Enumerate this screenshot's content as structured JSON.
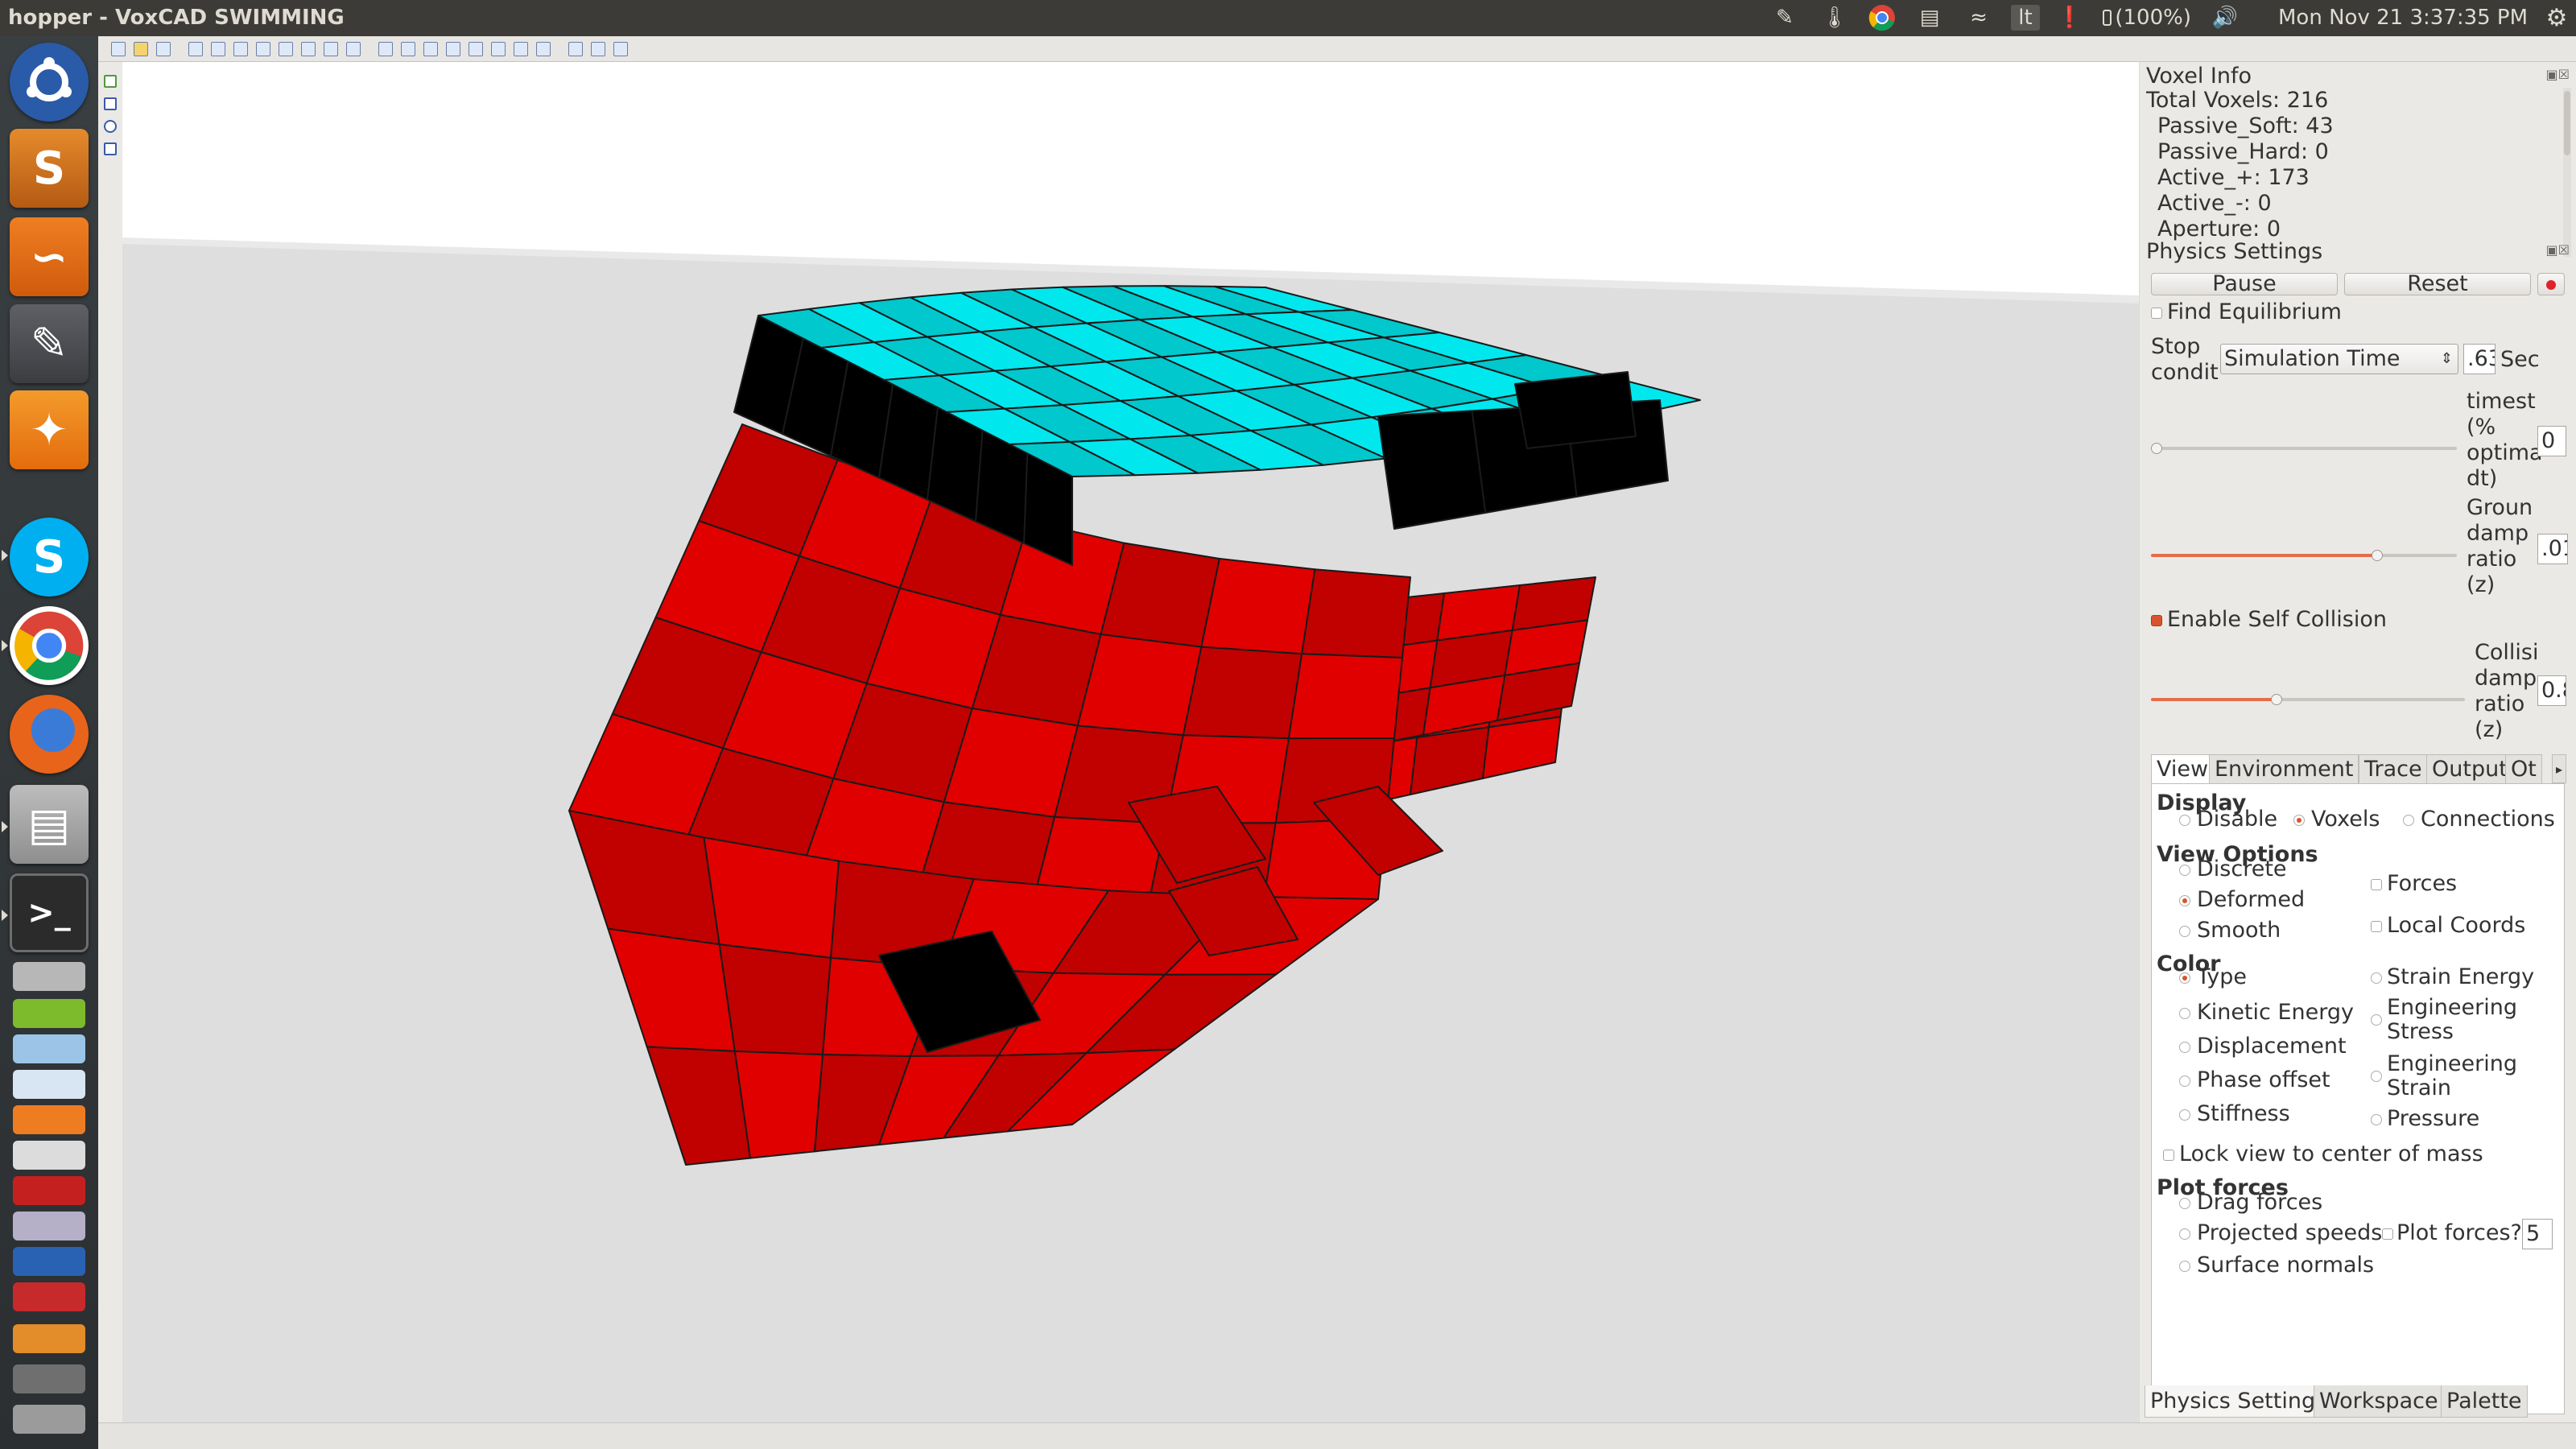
{
  "window": {
    "title": "hopper - VoxCAD SWIMMING"
  },
  "topbar": {
    "battery": "(100%)",
    "clock": "Mon Nov 21  3:37:35 PM",
    "keyboard": "lt"
  },
  "voxel_info": {
    "title": "Voxel Info",
    "lines": [
      "Total Voxels: 216",
      " Passive_Soft: 43",
      " Passive_Hard: 0",
      " Active_+: 173",
      " Active_-: 0",
      " Aperture: 0"
    ]
  },
  "physics": {
    "title": "Physics Settings",
    "pause_label": "Pause",
    "reset_label": "Reset",
    "find_equilibrium": "Find Equilibrium",
    "stop_label_1": "Stop",
    "stop_label_2": "condit",
    "stop_select": "Simulation Time",
    "stop_value": ".63",
    "stop_unit": "Sec",
    "timestep_label": [
      "timest",
      "(%",
      "optima",
      "dt)"
    ],
    "timestep_value": "0",
    "timestep_level": 0.0,
    "ground_label": [
      "Groun",
      "damp",
      "ratio",
      "(z)"
    ],
    "ground_value": ".01",
    "ground_level": 0.74,
    "self_collision": "Enable Self Collision",
    "coll_label": [
      "Collisi",
      "damp",
      "ratio",
      "(z)"
    ],
    "coll_value": "0.8",
    "coll_level": 0.4
  },
  "tabs": [
    "View",
    "Environment",
    "Trace",
    "Output",
    "Ot"
  ],
  "view": {
    "display_header": "Display",
    "disable": "Disable",
    "voxels": "Voxels",
    "connections": "Connections",
    "view_options_header": "View Options",
    "discrete": "Discrete",
    "deformed": "Deformed",
    "smooth": "Smooth",
    "forces": "Forces",
    "local_coords": "Local Coords",
    "color_header": "Color",
    "type": "Type",
    "kinetic_energy": "Kinetic Energy",
    "displacement": "Displacement",
    "phase_offset": "Phase offset",
    "stiffness": "Stiffness",
    "strain_energy": "Strain Energy",
    "eng_stress_1": "Engineering",
    "eng_stress_2": "Stress",
    "eng_strain_1": "Engineering",
    "eng_strain_2": "Strain",
    "pressure": "Pressure",
    "lock_view": "Lock view to center of mass",
    "plot_forces_header": "Plot forces",
    "drag_forces": "Drag forces",
    "projected_speeds": "Projected speeds",
    "plot_forces_q": "Plot forces?",
    "plot_forces_value": "5",
    "surface_normals": "Surface normals"
  },
  "bottom_tabs": [
    "Physics Settings",
    "Workspace",
    "Palette"
  ],
  "colors": {
    "active_voxel": "#e00000",
    "passive_voxel": "#00e8ee",
    "accent": "#d9522c"
  }
}
